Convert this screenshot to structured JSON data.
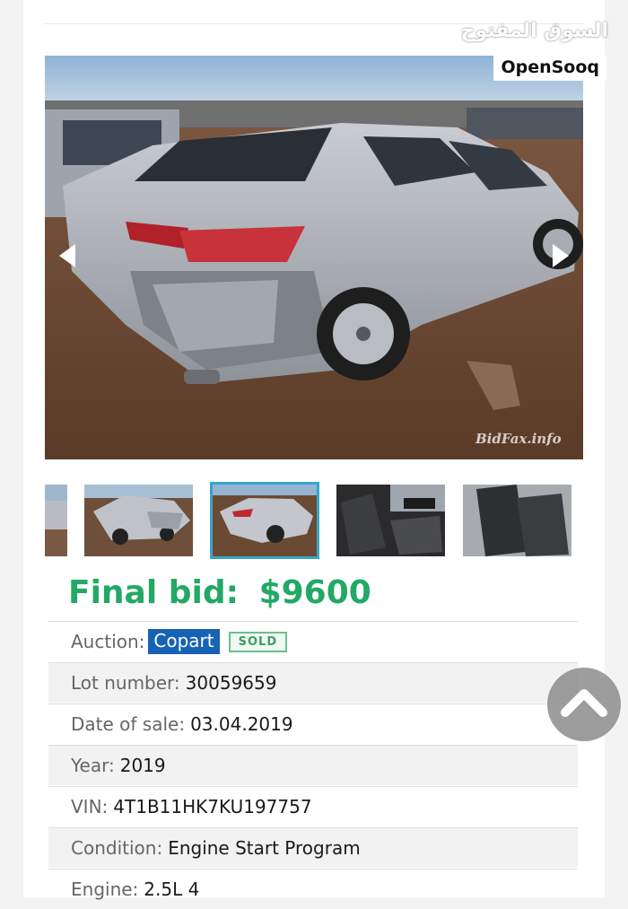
{
  "watermark": {
    "arabic": "السوق المفتوح",
    "latin": "OpenSooq"
  },
  "gallery": {
    "main_image_alt": "Silver sedan with rear-end damage in a salvage lot",
    "source_watermark": "BidFax.info",
    "prev_icon": "chevron-left-icon",
    "next_icon": "chevron-right-icon",
    "thumbnails": [
      "rear quarter exterior",
      "rear damage close",
      "rear damage (selected)",
      "front interior",
      "rear interior"
    ],
    "selected_index": 2
  },
  "listing": {
    "final_bid_label": "Final bid:",
    "final_bid_value": "$9600",
    "rows": [
      {
        "label": "Auction:",
        "value": "Copart",
        "badge": "SOLD"
      },
      {
        "label": "Lot number:",
        "value": "30059659"
      },
      {
        "label": "Date of sale:",
        "value": "03.04.2019"
      },
      {
        "label": "Year:",
        "value": "2019"
      },
      {
        "label": "VIN:",
        "value": "4T1B11HK7KU197757"
      },
      {
        "label": "Condition:",
        "value": "Engine Start Program"
      },
      {
        "label": "Engine:",
        "value": "2.5L 4"
      }
    ]
  },
  "scroll_top_icon": "chevron-up-icon",
  "colors": {
    "accent_green": "#23a866",
    "copart_blue": "#1762b4",
    "sold_green": "#3f9c64",
    "active_thumb_border": "#35a7c9"
  }
}
